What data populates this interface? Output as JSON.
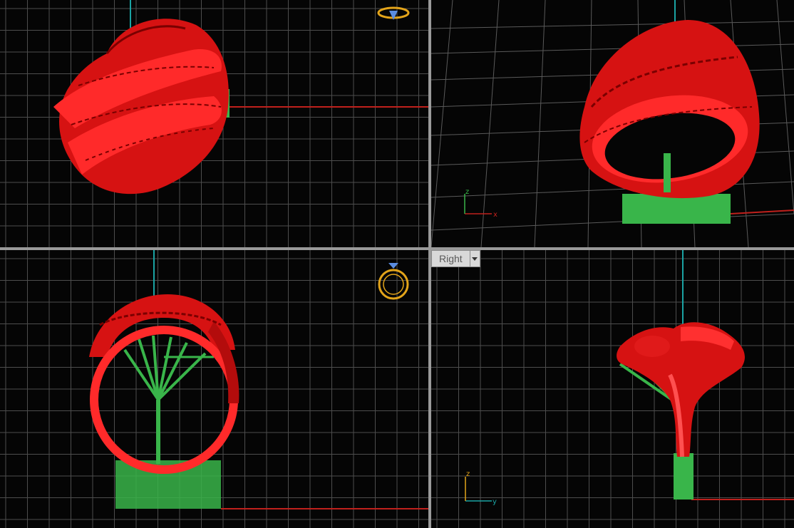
{
  "viewports": {
    "top": {
      "label": ""
    },
    "perspective": {
      "label": ""
    },
    "front": {
      "label": ""
    },
    "right": {
      "label": "Right"
    }
  },
  "axes": {
    "perspective": {
      "x": "x",
      "z": "z"
    },
    "right": {
      "y": "y",
      "z": "z"
    }
  },
  "icons": {
    "top_corner": "ring-top-view-icon",
    "front_corner": "ring-front-view-icon",
    "viewport_menu": "chevron-down-icon"
  },
  "colors": {
    "background": "#050505",
    "grid": "#4d4d4d",
    "grid_major": "#8c8c8c",
    "axis_x": "#c0201c",
    "axis_y": "#1aa3a3",
    "ring": "#e01414",
    "support": "#39b54a",
    "ring_icon": "#e3a41a",
    "gem_icon": "#5b8de0"
  }
}
